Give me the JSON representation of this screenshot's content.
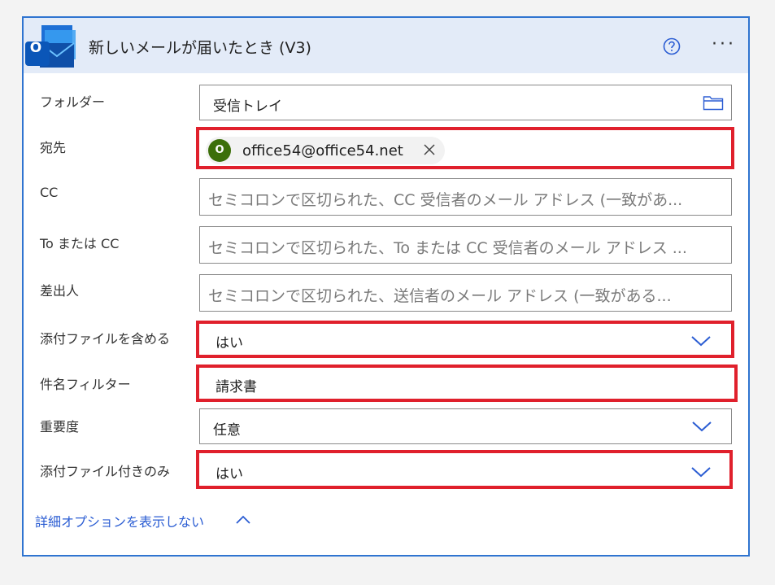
{
  "header": {
    "title": "新しいメールが届いたとき (V3)",
    "logo_letter": "O",
    "help_icon": "question-circle-icon",
    "more_icon": "more-horizontal-icon",
    "more_glyph": "···"
  },
  "fields": {
    "folder": {
      "label": "フォルダー",
      "value": "受信トレイ",
      "icon": "folder-icon"
    },
    "to": {
      "label": "宛先",
      "chip_initial": "O",
      "chip_email": "office54@office54.net",
      "chip_color": "#3c6f0a"
    },
    "cc": {
      "label": "CC",
      "placeholder": "セミコロンで区切られた、CC 受信者のメール アドレス (一致があ..."
    },
    "to_or_cc": {
      "label": "To または CC",
      "placeholder": "セミコロンで区切られた、To または CC 受信者のメール アドレス ..."
    },
    "from": {
      "label": "差出人",
      "placeholder": "セミコロンで区切られた、送信者のメール アドレス (一致がある..."
    },
    "include_attachments": {
      "label": "添付ファイルを含める",
      "value": "はい"
    },
    "subject_filter": {
      "label": "件名フィルター",
      "value": "請求書"
    },
    "importance": {
      "label": "重要度",
      "value": "任意"
    },
    "only_with_attachments": {
      "label": "添付ファイル付きのみ",
      "value": "はい"
    }
  },
  "advanced": {
    "label": "詳細オプションを表示しない"
  },
  "colors": {
    "accent": "#2f74d0",
    "highlight": "#e0202c",
    "link": "#2b5dd3",
    "header_bg": "#e3ebf8"
  }
}
